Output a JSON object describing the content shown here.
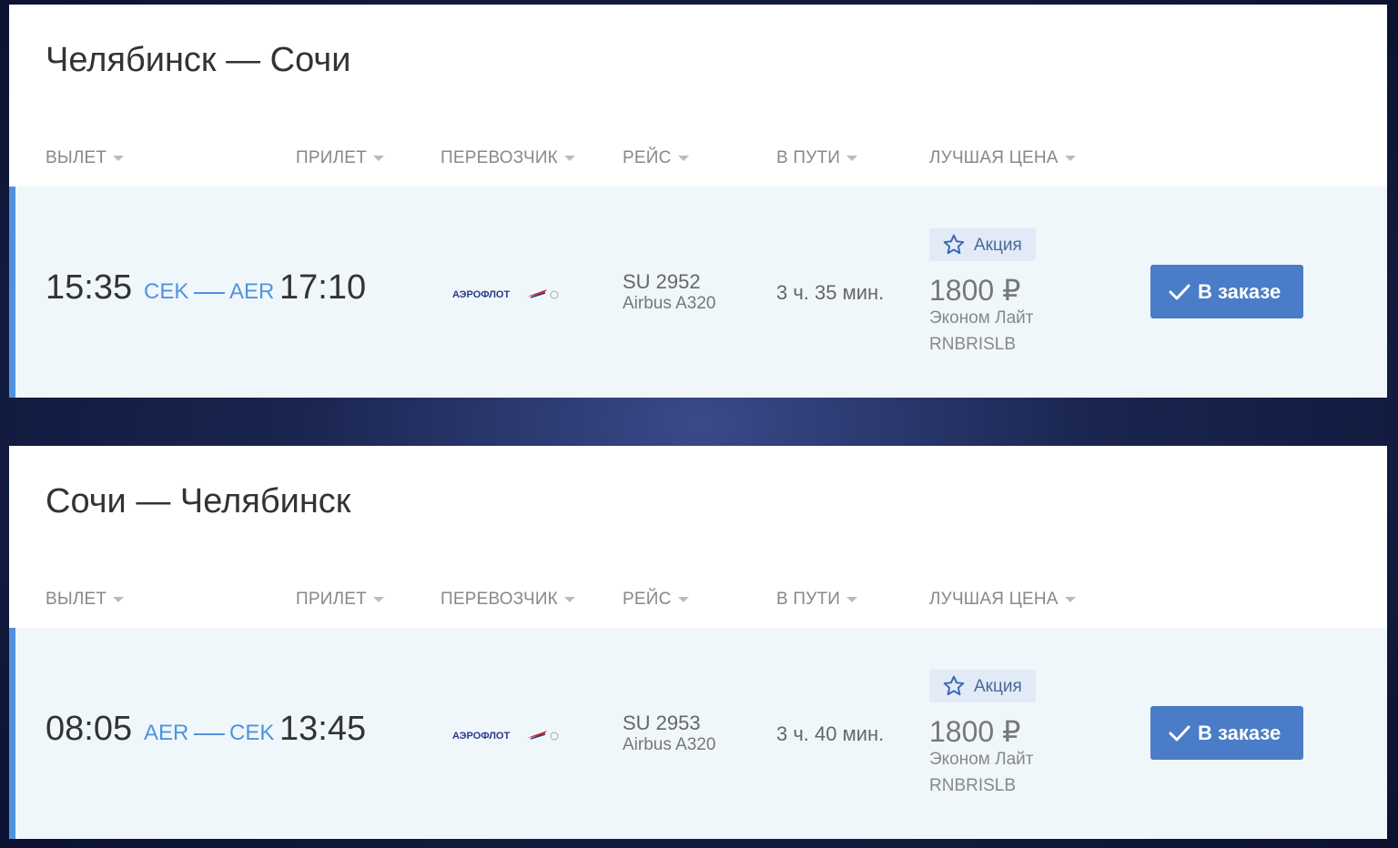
{
  "columns": {
    "departure": "ВЫЛЕТ",
    "arrival": "ПРИЛЕТ",
    "carrier": "ПЕРЕВОЗЧИК",
    "flight": "РЕЙС",
    "duration": "В ПУТИ",
    "best_price": "ЛУЧШАЯ ЦЕНА"
  },
  "routes": [
    {
      "title": "Челябинск — Сочи",
      "flight": {
        "dep_time": "15:35",
        "dep_code": "CEK",
        "arr_code": "AER",
        "arr_time": "17:10",
        "airline_logo_text": "АЭРОФЛОТ",
        "flight_number": "SU 2952",
        "aircraft": "Airbus A320",
        "duration": "3 ч. 35 мин.",
        "promo_label": "Акция",
        "price": "1800 ₽",
        "fare_class": "Эконом Лайт",
        "fare_code": "RNBRISLB",
        "button_label": "В заказе"
      }
    },
    {
      "title": "Сочи — Челябинск",
      "flight": {
        "dep_time": "08:05",
        "dep_code": "AER",
        "arr_code": "CEK",
        "arr_time": "13:45",
        "airline_logo_text": "АЭРОФЛОТ",
        "flight_number": "SU 2953",
        "aircraft": "Airbus A320",
        "duration": "3 ч. 40 мин.",
        "promo_label": "Акция",
        "price": "1800 ₽",
        "fare_class": "Эконом Лайт",
        "fare_code": "RNBRISLB",
        "button_label": "В заказе"
      }
    }
  ],
  "colors": {
    "accent": "#4f93e0",
    "button": "#4a7cc7",
    "row_bg": "#f0f7fb",
    "promo_bg": "#e1eaf6"
  }
}
